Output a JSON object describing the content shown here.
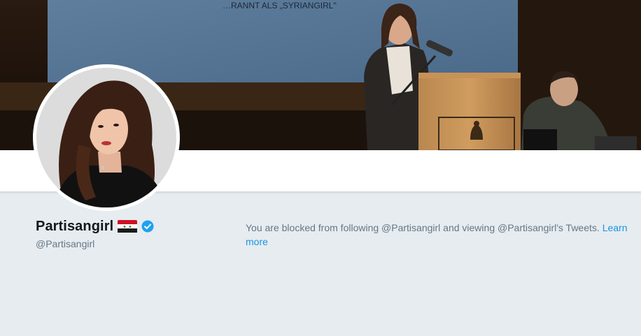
{
  "banner": {
    "slide_text": "…RANNT ALS „SYRIANGIRL\""
  },
  "profile": {
    "name": "Partisangirl",
    "flag_icon": "syria-flag-icon",
    "verified_icon": "verified-badge-icon",
    "handle": "@Partisangirl"
  },
  "blocked": {
    "message": "You are blocked from following @Partisangirl and viewing @Partisangirl's Tweets. ",
    "link_label": "Learn more"
  },
  "colors": {
    "background": "#e6ecf0",
    "link": "#1b95e0",
    "verified": "#1da1f2",
    "text_primary": "#14171a",
    "text_secondary": "#657786"
  }
}
